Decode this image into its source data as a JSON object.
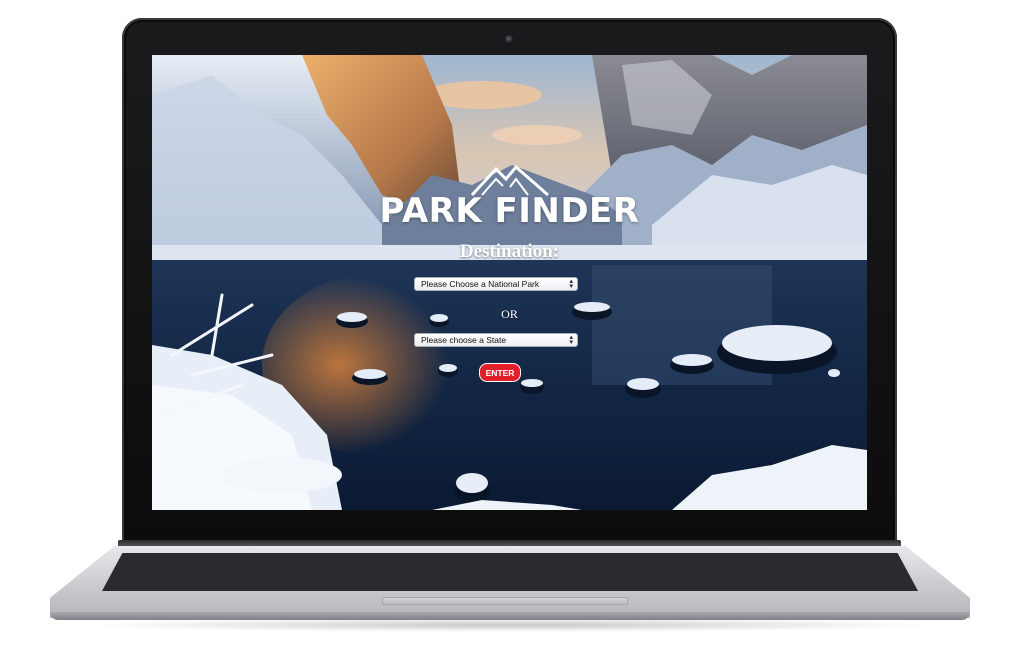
{
  "site": {
    "brand": "PARK FINDER",
    "destination_label": "Destination:",
    "park_select": {
      "selected": "Please Choose a National Park"
    },
    "or_label": "OR",
    "state_select": {
      "selected": "Please choose a State"
    },
    "enter_button": "ENTER"
  },
  "icons": {
    "logo": "mountain-logo-icon",
    "select_caret": "updown-caret-icon",
    "camera": "webcam-icon"
  },
  "colors": {
    "enter_button": "#e2202a",
    "brand_text": "#ffffff",
    "bezel": "#111113",
    "laptop_body": "#c9cbce"
  }
}
